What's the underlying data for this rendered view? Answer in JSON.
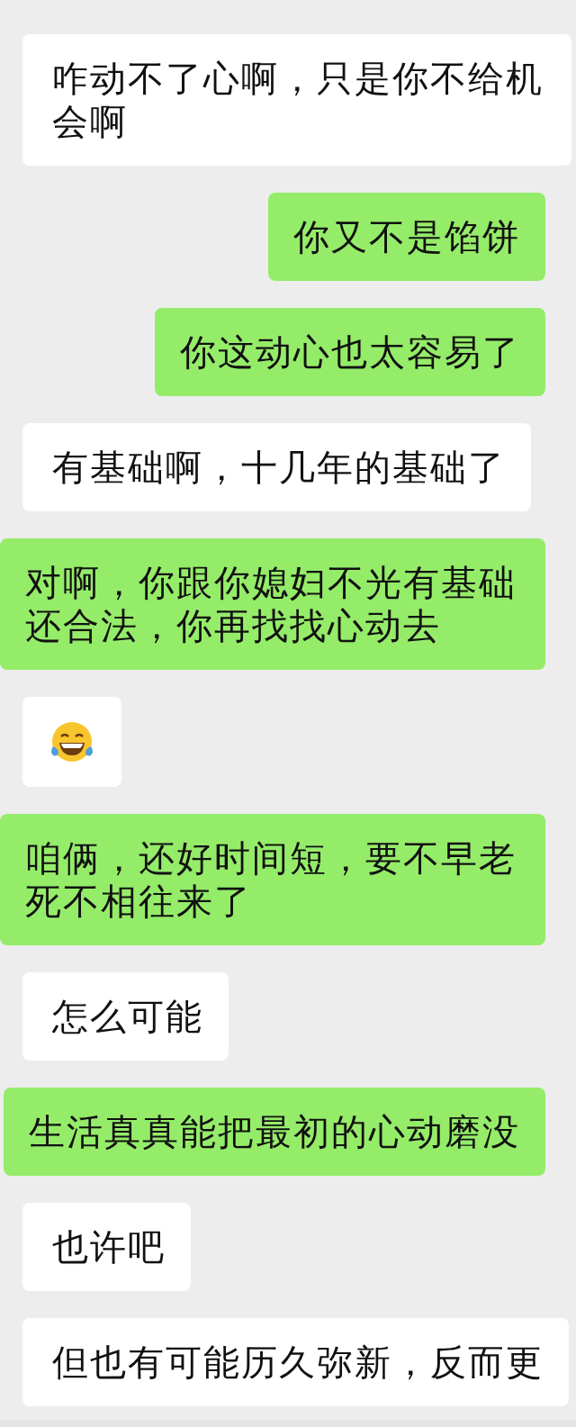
{
  "messages": [
    {
      "outgoing": false,
      "kind": "text",
      "text": "咋动不了心啊，只是你不给机会啊"
    },
    {
      "outgoing": true,
      "kind": "text",
      "text": "你又不是馅饼"
    },
    {
      "outgoing": true,
      "kind": "text",
      "text": "你这动心也太容易了"
    },
    {
      "outgoing": false,
      "kind": "text",
      "text": "有基础啊，十几年的基础了"
    },
    {
      "outgoing": true,
      "kind": "text",
      "text": "对啊，你跟你媳妇不光有基础还合法，你再找找心动去"
    },
    {
      "outgoing": false,
      "kind": "emoji"
    },
    {
      "outgoing": true,
      "kind": "text",
      "text": "咱俩，还好时间短，要不早老死不相往来了"
    },
    {
      "outgoing": false,
      "kind": "text",
      "text": "怎么可能"
    },
    {
      "outgoing": true,
      "kind": "text",
      "text": "生活真真能把最初的心动磨没"
    },
    {
      "outgoing": false,
      "kind": "text",
      "text": "也许吧"
    },
    {
      "outgoing": false,
      "kind": "text",
      "text": "但也有可能历久弥新，反而更"
    }
  ]
}
